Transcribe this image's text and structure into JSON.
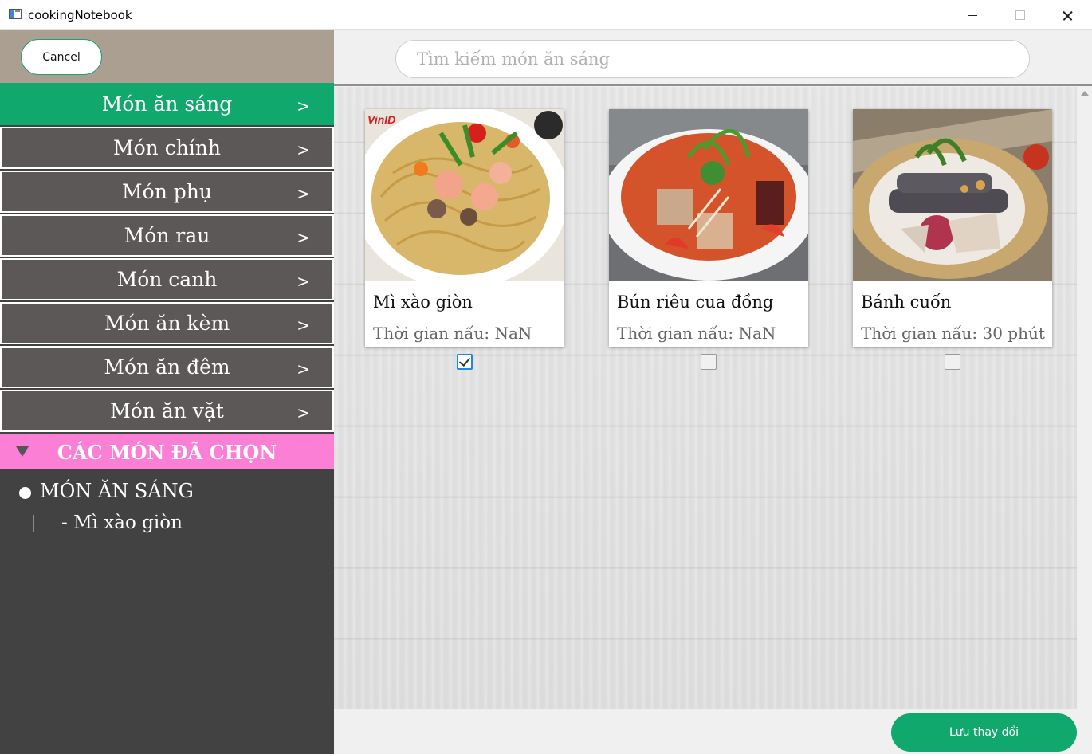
{
  "window": {
    "title": "cookingNotebook"
  },
  "sidebar": {
    "cancel_label": "Cancel",
    "categories": [
      {
        "label": "Món ăn sáng",
        "arrow": ">",
        "active": true
      },
      {
        "label": "Món chính",
        "arrow": ">"
      },
      {
        "label": "Món phụ",
        "arrow": ">"
      },
      {
        "label": "Món rau",
        "arrow": ">"
      },
      {
        "label": "Món canh",
        "arrow": ">"
      },
      {
        "label": "Món ăn kèm",
        "arrow": ">"
      },
      {
        "label": "Món ăn đêm",
        "arrow": ">"
      },
      {
        "label": "Món ăn vặt",
        "arrow": ">"
      }
    ],
    "selected_header": "CÁC MÓN ĐÃ CHỌN",
    "selected_groups": [
      {
        "label": "MÓN ĂN SÁNG",
        "items": [
          "- Mì xào giòn"
        ]
      }
    ]
  },
  "search": {
    "placeholder": "Tìm kiếm món ăn sáng",
    "value": ""
  },
  "dishes": [
    {
      "name": "Mì xào giòn",
      "time": "Thời gian nấu: NaN",
      "checked": true,
      "watermark": "VinID"
    },
    {
      "name": "Bún riêu cua đồng",
      "time": "Thời gian nấu: NaN",
      "checked": false
    },
    {
      "name": "Bánh cuốn",
      "time": "Thời gian nấu: 30 phút",
      "checked": false
    }
  ],
  "footer": {
    "save_label": "Lưu thay đổi"
  },
  "colors": {
    "accent": "#10a86c",
    "sidebar": "#424242",
    "category": "#5d5858",
    "selected_header": "#fc7fd6",
    "sidebar_top": "#ab9f92"
  }
}
